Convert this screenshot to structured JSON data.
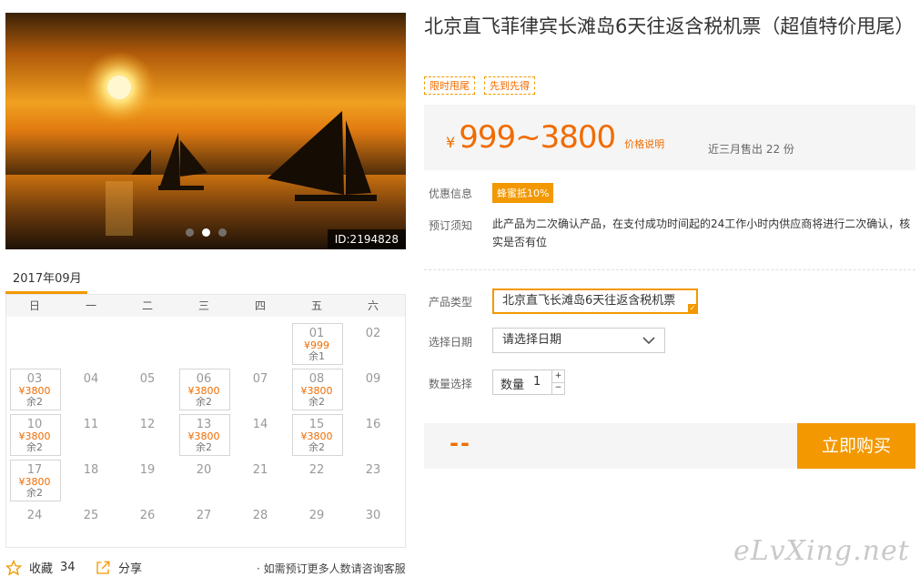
{
  "photo": {
    "id_label": "ID:2194828",
    "slides": [
      0,
      1,
      2
    ],
    "active_slide": 1
  },
  "calendar": {
    "month": "2017年09月",
    "weekdays": [
      "日",
      "一",
      "二",
      "三",
      "四",
      "五",
      "六"
    ],
    "weeks": [
      [
        null,
        null,
        null,
        null,
        null,
        {
          "d": "01",
          "p": "¥999",
          "r": "余1"
        },
        {
          "d": "02"
        }
      ],
      [
        {
          "d": "03",
          "p": "¥3800",
          "r": "余2"
        },
        {
          "d": "04"
        },
        {
          "d": "05"
        },
        {
          "d": "06",
          "p": "¥3800",
          "r": "余2"
        },
        {
          "d": "07"
        },
        {
          "d": "08",
          "p": "¥3800",
          "r": "余2"
        },
        {
          "d": "09"
        }
      ],
      [
        {
          "d": "10",
          "p": "¥3800",
          "r": "余2"
        },
        {
          "d": "11"
        },
        {
          "d": "12"
        },
        {
          "d": "13",
          "p": "¥3800",
          "r": "余2"
        },
        {
          "d": "14"
        },
        {
          "d": "15",
          "p": "¥3800",
          "r": "余2"
        },
        {
          "d": "16"
        }
      ],
      [
        {
          "d": "17",
          "p": "¥3800",
          "r": "余2"
        },
        {
          "d": "18"
        },
        {
          "d": "19"
        },
        {
          "d": "20"
        },
        {
          "d": "21"
        },
        {
          "d": "22"
        },
        {
          "d": "23"
        }
      ],
      [
        {
          "d": "24"
        },
        {
          "d": "25"
        },
        {
          "d": "26"
        },
        {
          "d": "27"
        },
        {
          "d": "28"
        },
        {
          "d": "29"
        },
        {
          "d": "30"
        }
      ]
    ]
  },
  "footer": {
    "favorite_label": "收藏",
    "favorite_count": "34",
    "share_label": "分享",
    "note": "· 如需预订更多人数请咨询客服"
  },
  "product": {
    "title": "北京直飞菲律宾长滩岛6天往返含税机票（超值特价甩尾）",
    "tags": [
      "限时甩尾",
      "先到先得"
    ],
    "price_currency": "¥",
    "price_range": "999~3800",
    "price_explain": "价格说明",
    "sold": "近三月售出 22 份",
    "discount_label": "优惠信息",
    "discount_badge": "蜂蜜抵10%",
    "notice_label": "预订须知",
    "notice_text": "此产品为二次确认产品，在支付成功时间起的24工作小时内供应商将进行二次确认，核实是否有位",
    "type_label": "产品类型",
    "type_value": "北京直飞长滩岛6天往返含税机票",
    "date_label": "选择日期",
    "date_placeholder": "请选择日期",
    "qty_label": "数量选择",
    "qty_inner_label": "数量",
    "qty_value": "1",
    "qty_up": "+",
    "qty_down": "−",
    "total": "--",
    "buy_button": "立即购买"
  },
  "watermark": "eLvXing.net",
  "colors": {
    "accent": "#f39800",
    "price": "#f06c00"
  },
  "icons": {
    "favorite": "star-icon",
    "share": "share-icon",
    "date_dropdown": "chevron-down-icon",
    "type_selected": "check-icon"
  }
}
